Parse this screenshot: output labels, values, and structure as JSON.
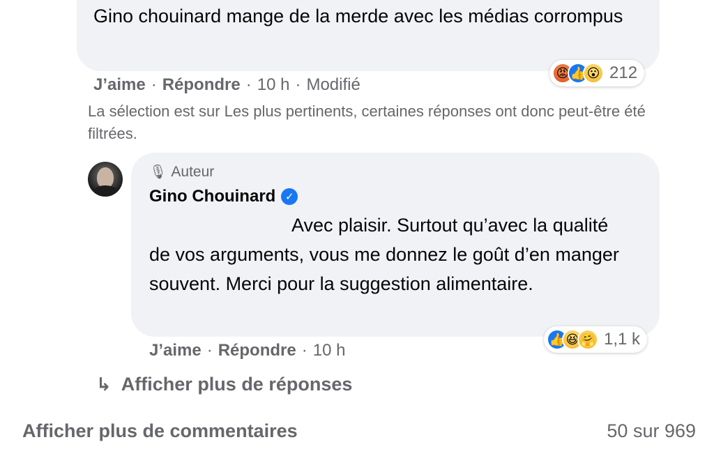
{
  "top_comment": {
    "text": "Gino chouinard mange de la merde avec les médias corrompus",
    "reactions": {
      "icons": [
        "angry-icon",
        "like-icon",
        "wow-icon"
      ],
      "count": "212"
    },
    "actions": {
      "like": "J’aime",
      "reply": "Répondre",
      "time": "10 h",
      "edited": "Modifié"
    }
  },
  "filter_notice": "La sélection est sur Les plus pertinents, certaines réponses ont donc peut-être été filtrées.",
  "reply": {
    "badge": "Auteur",
    "author": "Gino Chouinard",
    "text": "Avec plaisir. Surtout qu’avec la qualité de vos arguments, vous me donnez le goût d’en manger souvent. Merci pour la suggestion alimentaire.",
    "reactions": {
      "icons": [
        "like-icon",
        "haha-icon",
        "care-icon"
      ],
      "count": "1,1 k"
    },
    "actions": {
      "like": "J’aime",
      "reply": "Répondre",
      "time": "10 h"
    }
  },
  "more_replies": "Afficher plus de réponses",
  "more_comments": "Afficher plus de commentaires",
  "comment_count": "50 sur 969",
  "colors": {
    "bubble": "#f0f2f5",
    "secondary_text": "#65676b",
    "accent_blue": "#1877f2"
  }
}
